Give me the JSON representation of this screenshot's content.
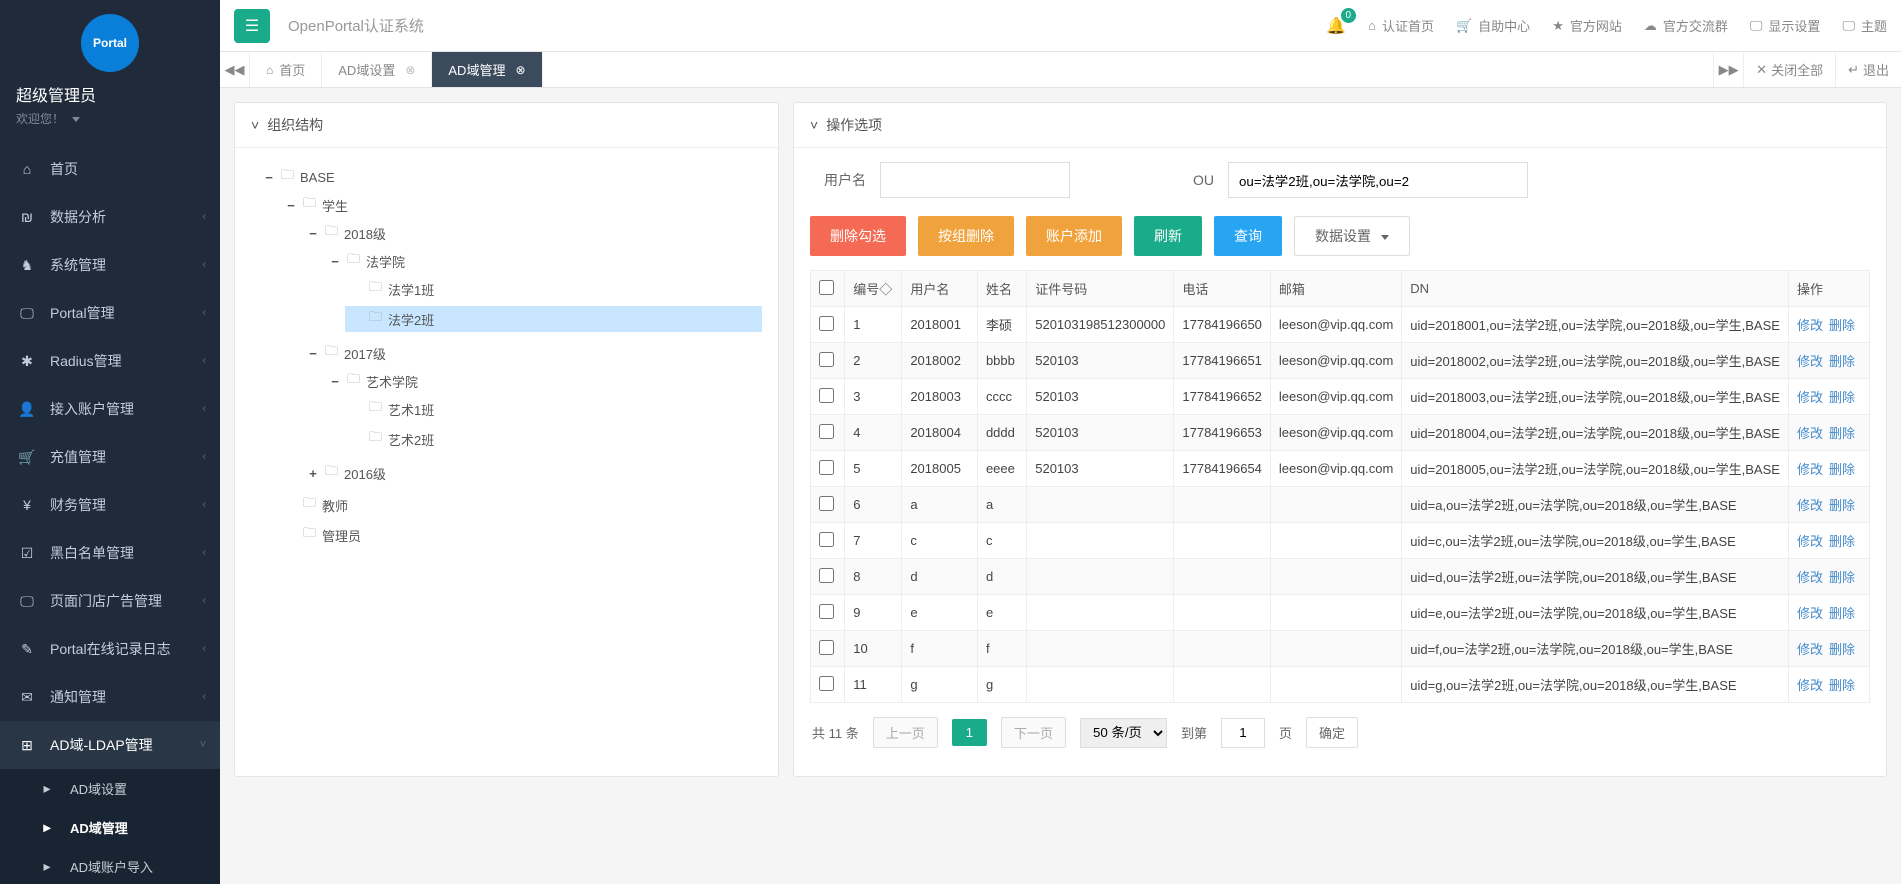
{
  "sidebar": {
    "user_name": "超级管理员",
    "welcome": "欢迎您！",
    "items": [
      {
        "icon": "⌂",
        "label": "首页",
        "has_children": false
      },
      {
        "icon": "₪",
        "label": "数据分析",
        "has_children": true
      },
      {
        "icon": "♞",
        "label": "系统管理",
        "has_children": true
      },
      {
        "icon": "🖵",
        "label": "Portal管理",
        "has_children": true
      },
      {
        "icon": "✱",
        "label": "Radius管理",
        "has_children": true
      },
      {
        "icon": "👤",
        "label": "接入账户管理",
        "has_children": true
      },
      {
        "icon": "🛒",
        "label": "充值管理",
        "has_children": true
      },
      {
        "icon": "¥",
        "label": "财务管理",
        "has_children": true
      },
      {
        "icon": "☑",
        "label": "黑白名单管理",
        "has_children": true
      },
      {
        "icon": "🖵",
        "label": "页面门店广告管理",
        "has_children": true
      },
      {
        "icon": "✎",
        "label": "Portal在线记录日志",
        "has_children": true
      },
      {
        "icon": "✉",
        "label": "通知管理",
        "has_children": true
      },
      {
        "icon": "⊞",
        "label": "AD域-LDAP管理",
        "has_children": true,
        "expanded": true,
        "children": [
          {
            "label": "AD域设置"
          },
          {
            "label": "AD域管理",
            "current": true
          },
          {
            "label": "AD域账户导入"
          }
        ]
      }
    ]
  },
  "topbar": {
    "brand": "OpenPortal认证系统",
    "notif_count": "0",
    "links": [
      {
        "icon": "⌂",
        "label": "认证首页"
      },
      {
        "icon": "🛒",
        "label": "自助中心"
      },
      {
        "icon": "★",
        "label": "官方网站"
      },
      {
        "icon": "☁",
        "label": "官方交流群"
      },
      {
        "icon": "🖵",
        "label": "显示设置"
      },
      {
        "icon": "🖵",
        "label": "主题"
      }
    ]
  },
  "tabs": {
    "items": [
      {
        "icon": "⌂",
        "label": "首页",
        "closable": false
      },
      {
        "icon": "",
        "label": "AD域设置",
        "closable": true
      },
      {
        "icon": "",
        "label": "AD域管理",
        "closable": true,
        "active": true
      }
    ],
    "close_all": "关闭全部",
    "logout": "退出"
  },
  "left_panel": {
    "title": "组织结构",
    "tree": {
      "root": "BASE",
      "l1": "学生",
      "g2018": "2018级",
      "fxy": "法学院",
      "fx1": "法学1班",
      "fx2": "法学2班",
      "g2017": "2017级",
      "ysxy": "艺术学院",
      "ys1": "艺术1班",
      "ys2": "艺术2班",
      "g2016": "2016级",
      "teacher": "教师",
      "admin": "管理员"
    }
  },
  "right_panel": {
    "title": "操作选项",
    "form": {
      "user_label": "用户名",
      "ou_label": "OU",
      "ou_value": "ou=法学2班,ou=法学院,ou=2"
    },
    "buttons": {
      "del_sel": "删除勾选",
      "del_group": "按组删除",
      "add": "账户添加",
      "refresh": "刷新",
      "query": "查询",
      "data_cfg": "数据设置"
    },
    "columns": {
      "idx": "编号◇",
      "user": "用户名",
      "name": "姓名",
      "id": "证件号码",
      "phone": "电话",
      "mail": "邮箱",
      "dn": "DN",
      "op": "操作"
    },
    "op": {
      "edit": "修改",
      "del": "删除"
    },
    "rows": [
      {
        "idx": "1",
        "user": "2018001",
        "name": "李硕",
        "id": "520103198512300000",
        "phone": "17784196650",
        "mail": "leeson@vip.qq.com",
        "dn": "uid=2018001,ou=法学2班,ou=法学院,ou=2018级,ou=学生,BASE"
      },
      {
        "idx": "2",
        "user": "2018002",
        "name": "bbbb",
        "id": "520103",
        "phone": "17784196651",
        "mail": "leeson@vip.qq.com",
        "dn": "uid=2018002,ou=法学2班,ou=法学院,ou=2018级,ou=学生,BASE"
      },
      {
        "idx": "3",
        "user": "2018003",
        "name": "cccc",
        "id": "520103",
        "phone": "17784196652",
        "mail": "leeson@vip.qq.com",
        "dn": "uid=2018003,ou=法学2班,ou=法学院,ou=2018级,ou=学生,BASE"
      },
      {
        "idx": "4",
        "user": "2018004",
        "name": "dddd",
        "id": "520103",
        "phone": "17784196653",
        "mail": "leeson@vip.qq.com",
        "dn": "uid=2018004,ou=法学2班,ou=法学院,ou=2018级,ou=学生,BASE"
      },
      {
        "idx": "5",
        "user": "2018005",
        "name": "eeee",
        "id": "520103",
        "phone": "17784196654",
        "mail": "leeson@vip.qq.com",
        "dn": "uid=2018005,ou=法学2班,ou=法学院,ou=2018级,ou=学生,BASE"
      },
      {
        "idx": "6",
        "user": "a",
        "name": "a",
        "id": "",
        "phone": "",
        "mail": "",
        "dn": "uid=a,ou=法学2班,ou=法学院,ou=2018级,ou=学生,BASE"
      },
      {
        "idx": "7",
        "user": "c",
        "name": "c",
        "id": "",
        "phone": "",
        "mail": "",
        "dn": "uid=c,ou=法学2班,ou=法学院,ou=2018级,ou=学生,BASE"
      },
      {
        "idx": "8",
        "user": "d",
        "name": "d",
        "id": "",
        "phone": "",
        "mail": "",
        "dn": "uid=d,ou=法学2班,ou=法学院,ou=2018级,ou=学生,BASE"
      },
      {
        "idx": "9",
        "user": "e",
        "name": "e",
        "id": "",
        "phone": "",
        "mail": "",
        "dn": "uid=e,ou=法学2班,ou=法学院,ou=2018级,ou=学生,BASE"
      },
      {
        "idx": "10",
        "user": "f",
        "name": "f",
        "id": "",
        "phone": "",
        "mail": "",
        "dn": "uid=f,ou=法学2班,ou=法学院,ou=2018级,ou=学生,BASE"
      },
      {
        "idx": "11",
        "user": "g",
        "name": "g",
        "id": "",
        "phone": "",
        "mail": "",
        "dn": "uid=g,ou=法学2班,ou=法学院,ou=2018级,ou=学生,BASE"
      }
    ],
    "pager": {
      "total": "共 11 条",
      "prev": "上一页",
      "page": "1",
      "next": "下一页",
      "page_size": "50 条/页",
      "goto": "到第",
      "goto_val": "1",
      "goto_suffix": "页",
      "confirm": "确定"
    }
  }
}
